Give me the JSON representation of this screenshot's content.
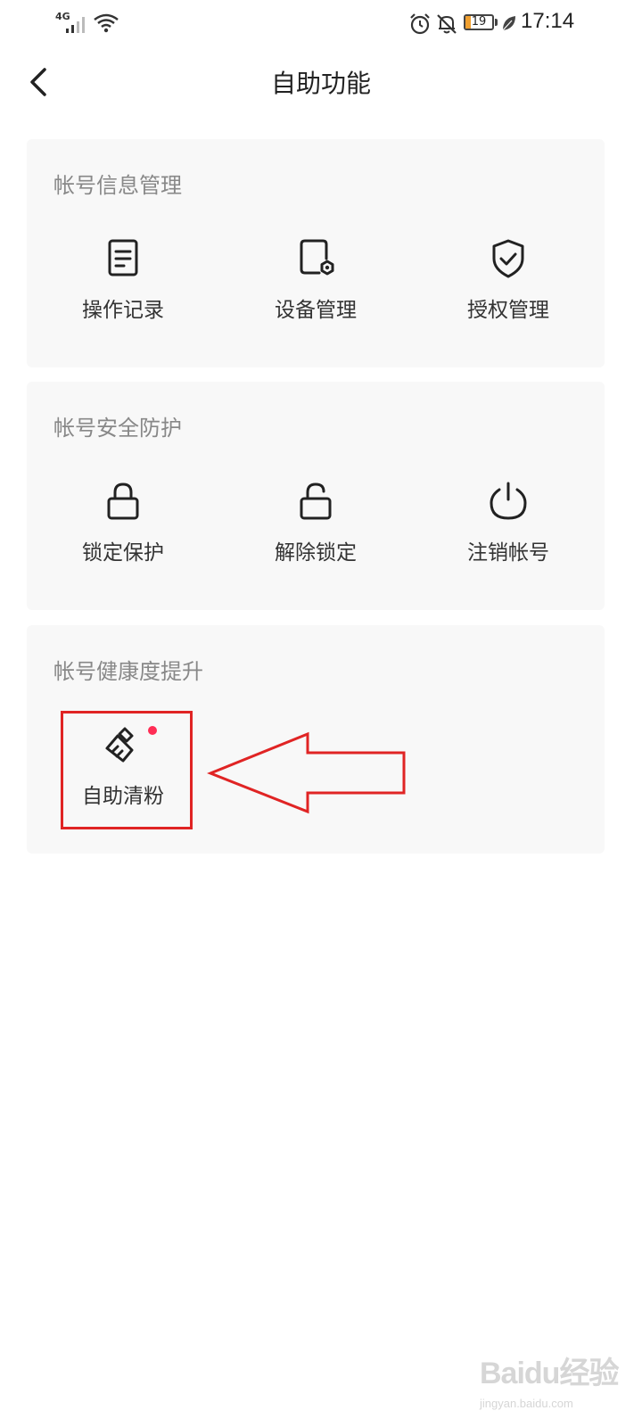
{
  "status_bar": {
    "network": "4G",
    "battery": "19",
    "time": "17:14",
    "icons": [
      "signal-icon",
      "wifi-icon",
      "alarm-icon",
      "mute-bell-icon",
      "battery-icon",
      "leaf-icon"
    ],
    "battery_color": "#f0a030"
  },
  "header": {
    "title": "自助功能"
  },
  "sections": [
    {
      "title": "帐号信息管理",
      "items": [
        {
          "label": "操作记录",
          "icon": "document-icon"
        },
        {
          "label": "设备管理",
          "icon": "device-settings-icon"
        },
        {
          "label": "授权管理",
          "icon": "shield-check-icon"
        }
      ]
    },
    {
      "title": "帐号安全防护",
      "items": [
        {
          "label": "锁定保护",
          "icon": "lock-icon"
        },
        {
          "label": "解除锁定",
          "icon": "unlock-icon"
        },
        {
          "label": "注销帐号",
          "icon": "power-icon"
        }
      ]
    },
    {
      "title": "帐号健康度提升",
      "items": [
        {
          "label": "自助清粉",
          "icon": "brush-icon",
          "badge": "red-dot"
        }
      ]
    }
  ],
  "annotation": {
    "color": "#e02424"
  },
  "watermark": {
    "logo": "Baidu经验",
    "url": "jingyan.baidu.com"
  }
}
